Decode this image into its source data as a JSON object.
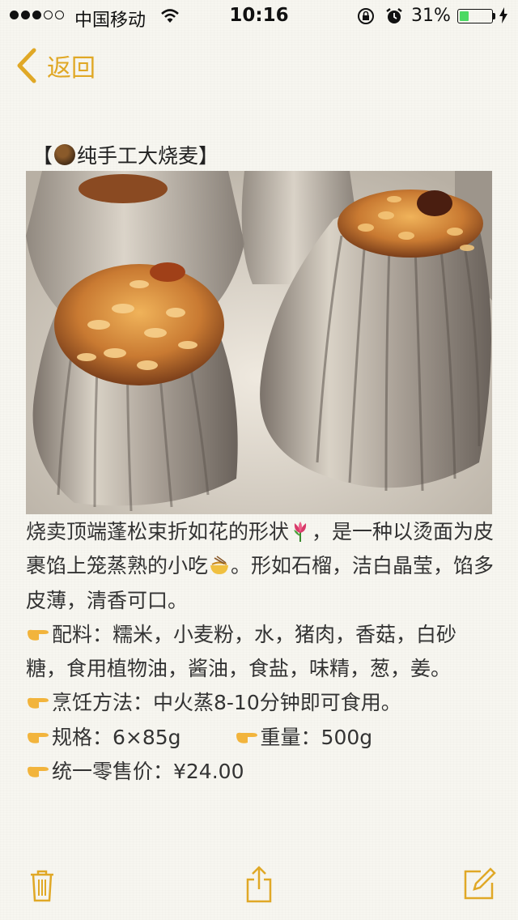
{
  "status_bar": {
    "carrier": "中国移动",
    "time": "10:16",
    "battery_percent": "31%",
    "battery_level": 0.31,
    "icons": [
      "signal-dots",
      "wifi-icon",
      "orientation-lock-icon",
      "alarm-icon",
      "charging-icon"
    ]
  },
  "nav": {
    "back_label": "返回"
  },
  "note": {
    "title_prefix": "【",
    "title_text": "纯手工大烧麦】",
    "intro_1": "烧卖顶端蓬松束折如花的形状",
    "intro_2": "，是一种以烫面为皮裹馅上笼蒸熟的小吃",
    "intro_3": "。形如石榴，洁白晶莹，馅多皮薄，清香可口。",
    "ingredients": "配料：糯米，小麦粉，水，猪肉，香菇，白砂糖，食用植物油，酱油，食盐，味精，葱，姜。",
    "method": "烹饪方法：中火蒸8-10分钟即可食用。",
    "spec": "规格：6×85g",
    "weight": "重量：500g",
    "price": "统一零售价：¥24.00"
  },
  "colors": {
    "accent": "#e0a826",
    "background": "#f7f6f0",
    "text": "#333333"
  },
  "toolbar": {
    "icons": [
      "trash-icon",
      "share-icon",
      "compose-icon"
    ]
  }
}
